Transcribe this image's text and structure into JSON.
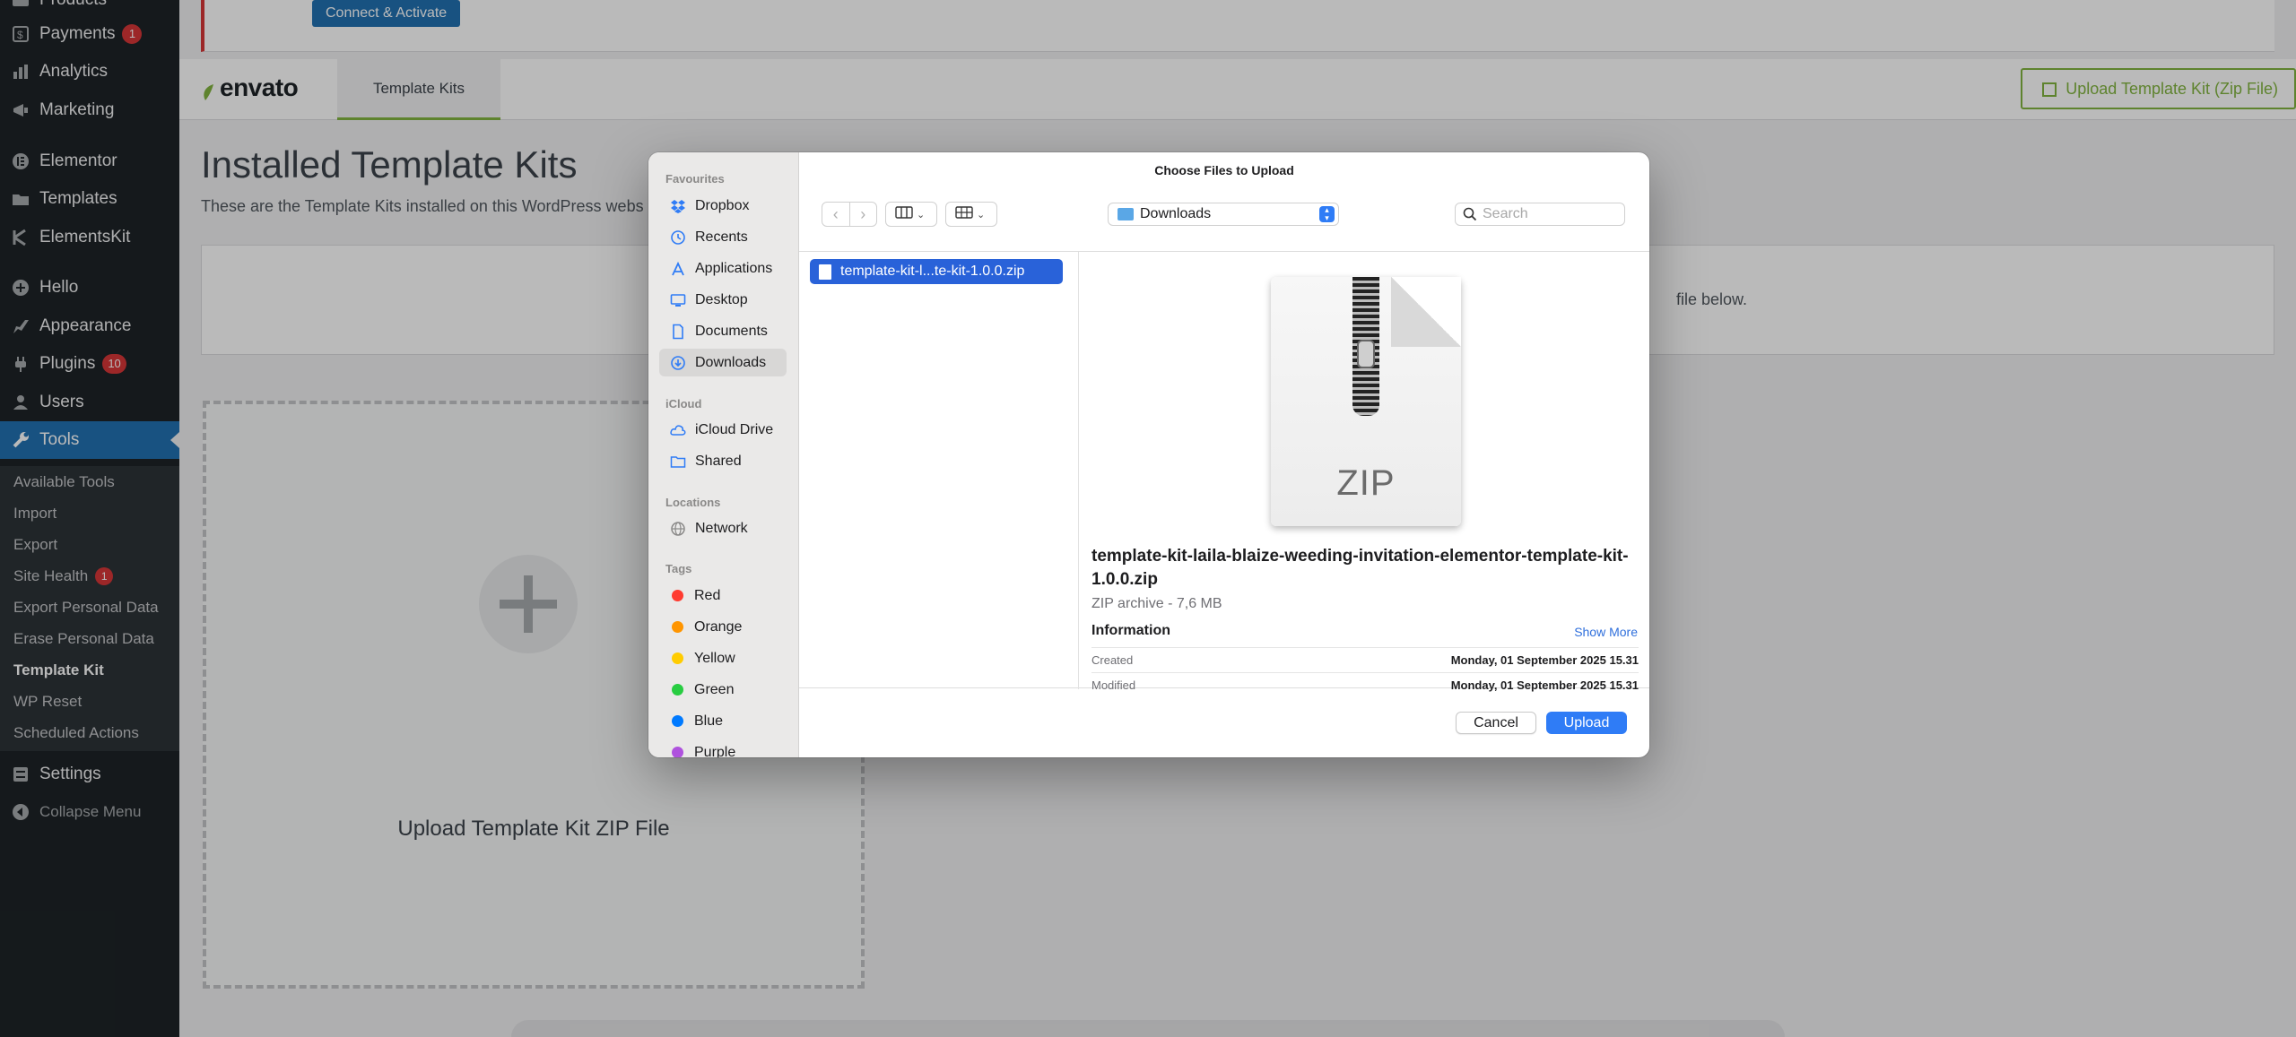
{
  "sidebar": {
    "items": [
      {
        "label": "Products",
        "icon": "products-icon",
        "badge": ""
      },
      {
        "label": "Payments",
        "icon": "payments-icon",
        "badge": "1"
      },
      {
        "label": "Analytics",
        "icon": "analytics-icon",
        "badge": ""
      },
      {
        "label": "Marketing",
        "icon": "marketing-icon",
        "badge": ""
      },
      {
        "label": "Elementor",
        "icon": "elementor-icon",
        "badge": ""
      },
      {
        "label": "Templates",
        "icon": "templates-icon",
        "badge": ""
      },
      {
        "label": "ElementsKit",
        "icon": "elementskit-icon",
        "badge": ""
      },
      {
        "label": "Hello",
        "icon": "hello-icon",
        "badge": ""
      },
      {
        "label": "Appearance",
        "icon": "appearance-icon",
        "badge": ""
      },
      {
        "label": "Plugins",
        "icon": "plugins-icon",
        "badge": "10"
      },
      {
        "label": "Users",
        "icon": "users-icon",
        "badge": ""
      },
      {
        "label": "Tools",
        "icon": "tools-icon",
        "badge": ""
      },
      {
        "label": "Settings",
        "icon": "settings-icon",
        "badge": ""
      },
      {
        "label": "Collapse Menu",
        "icon": "collapse-icon",
        "badge": ""
      }
    ],
    "tools_submenu": [
      {
        "label": "Available Tools",
        "badge": ""
      },
      {
        "label": "Import",
        "badge": ""
      },
      {
        "label": "Export",
        "badge": ""
      },
      {
        "label": "Site Health",
        "badge": "1"
      },
      {
        "label": "Export Personal Data",
        "badge": ""
      },
      {
        "label": "Erase Personal Data",
        "badge": ""
      },
      {
        "label": "Template Kit",
        "badge": ""
      },
      {
        "label": "WP Reset",
        "badge": ""
      },
      {
        "label": "Scheduled Actions",
        "badge": ""
      }
    ]
  },
  "notice": {
    "connect_label": "Connect & Activate"
  },
  "envato": {
    "logo_text": "envato",
    "tab_label": "Template Kits",
    "upload_button": "Upload Template Kit (Zip File)",
    "accent": "#82b440"
  },
  "page": {
    "title": "Installed Template Kits",
    "subtitle": "These are the Template Kits installed on this WordPress webs",
    "panel_text": "file below.",
    "dropzone_label": "Upload Template Kit ZIP File"
  },
  "dialog": {
    "title": "Choose Files to Upload",
    "sections": {
      "favourites": "Favourites",
      "icloud": "iCloud",
      "locations": "Locations",
      "tags": "Tags"
    },
    "favourites": [
      {
        "label": "Dropbox",
        "icon": "dropbox-icon"
      },
      {
        "label": "Recents",
        "icon": "clock-icon"
      },
      {
        "label": "Applications",
        "icon": "applications-icon"
      },
      {
        "label": "Desktop",
        "icon": "desktop-icon"
      },
      {
        "label": "Documents",
        "icon": "document-icon"
      },
      {
        "label": "Downloads",
        "icon": "download-icon"
      }
    ],
    "icloud": [
      {
        "label": "iCloud Drive",
        "icon": "cloud-icon"
      },
      {
        "label": "Shared",
        "icon": "shared-folder-icon"
      }
    ],
    "locations": [
      {
        "label": "Network",
        "icon": "globe-icon"
      }
    ],
    "tags": [
      {
        "label": "Red",
        "color": "#ff3b30"
      },
      {
        "label": "Orange",
        "color": "#ff9500"
      },
      {
        "label": "Yellow",
        "color": "#ffcc00"
      },
      {
        "label": "Green",
        "color": "#28cd41"
      },
      {
        "label": "Blue",
        "color": "#007aff"
      },
      {
        "label": "Purple",
        "color": "#af52de"
      }
    ],
    "location_select": "Downloads",
    "search_placeholder": "Search",
    "selected_file": "template-kit-l...te-kit-1.0.0.zip",
    "preview": {
      "icon_label": "ZIP",
      "file_name": "template-kit-laila-blaize-weeding-invitation-elementor-template-kit-1.0.0.zip",
      "meta": "ZIP archive - 7,6 MB",
      "info_heading": "Information",
      "show_more": "Show More",
      "rows": [
        {
          "key": "Created",
          "value": "Monday, 01 September 2025 15.31"
        },
        {
          "key": "Modified",
          "value": "Monday, 01 September 2025 15.31"
        }
      ]
    },
    "cancel_label": "Cancel",
    "upload_label": "Upload",
    "accent": "#2f7cf6"
  }
}
